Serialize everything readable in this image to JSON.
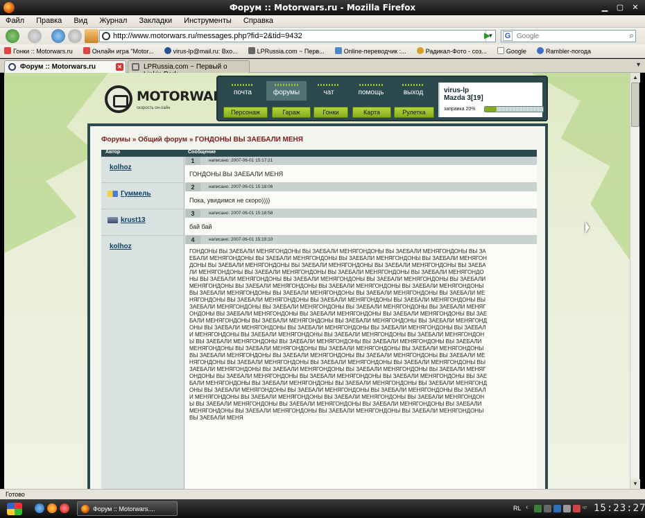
{
  "window": {
    "title": "Форум :: Motorwars.ru - Mozilla Firefox"
  },
  "menu": [
    "Файл",
    "Правка",
    "Вид",
    "Журнал",
    "Закладки",
    "Инструменты",
    "Справка"
  ],
  "url": "http://www.motorwars.ru/messages.php?fid=2&tid=9432",
  "search": {
    "placeholder": "Google",
    "engine_letter": "G"
  },
  "bookmarks": [
    "Гонки :: Motorwars.ru",
    "Онлайн игра \"Motor...",
    "virus-lp@mail.ru: Вхо...",
    "LPRussia.com ~ Перв...",
    "Online-переводчик :...",
    "Радикал-Фото - coз...",
    "Google",
    "Rambler-погода"
  ],
  "tabs": [
    {
      "label": "Форум :: Motorwars.ru",
      "active": true
    },
    {
      "label": "LPRussia.com ~ Первый о Linkin Park ...",
      "active": false
    }
  ],
  "site": {
    "logo": "MOTORWARS.RU",
    "tagline": "скорость он-лайн",
    "top_nav": [
      "почта",
      "форумы",
      "чат",
      "помощь",
      "выход"
    ],
    "sub_nav": [
      "Персонаж",
      "Гараж",
      "Гонки",
      "Карта",
      "Рулетка"
    ],
    "user": {
      "name": "virus-lp",
      "car": "Mazda 3[19]",
      "fuel_label": "заправка 20%",
      "fuel": 0.2
    }
  },
  "breadcrumb": {
    "forums": "Форумы",
    "sep1": "»",
    "general": "Общий форум",
    "sep2": "»",
    "topic": "ГОНДОНЫ ВЫ ЗАЕБАЛИ МЕНЯ"
  },
  "table": {
    "col_author": "Автор",
    "col_message": "Сообщение"
  },
  "posts": [
    {
      "num": "1",
      "author": "kolhoz",
      "date": "написано: 2007-06-01 15:17:21",
      "text": "ГОНДОНЫ ВЫ ЗАЕБАЛИ МЕНЯ"
    },
    {
      "num": "2",
      "author": "Гуммель",
      "date": "написано: 2007-06-01 15:18:06",
      "text": "Пока, увидимся не скоро))))"
    },
    {
      "num": "3",
      "author": "krust13",
      "date": "написано: 2007-06-01 15:18:58",
      "text": "бай бай"
    },
    {
      "num": "4",
      "author": "kolhoz",
      "date": "написано: 2007-06-01 15:19:10",
      "text": "ГОНДОНЫ ВЫ ЗАЕБАЛИ МЕНЯГОНДОНЫ ВЫ ЗАЕБАЛИ МЕНЯГОНДОНЫ ВЫ ЗАЕБАЛИ МЕНЯГОНДОНЫ ВЫ ЗАЕБАЛИ МЕНЯГОНДОНЫ ВЫ ЗАЕБАЛИ МЕНЯГОНДОНЫ ВЫ ЗАЕБАЛИ МЕНЯГОНДОНЫ ВЫ ЗАЕБАЛИ МЕНЯГОНДОНЫ ВЫ ЗАЕБАЛИ МЕНЯГОНДОНЫ ВЫ ЗАЕБАЛИ МЕНЯГОНДОНЫ ВЫ ЗАЕБАЛИ МЕНЯГОНДОНЫ ВЫ ЗАЕБАЛИ МЕНЯГОНДОНЫ ВЫ ЗАЕБАЛИ МЕНЯГОНДОНЫ ВЫ ЗАЕБАЛИ МЕНЯГОНДОНЫ ВЫ ЗАЕБАЛИ МЕНЯГОНДОНЫ ВЫ ЗАЕБАЛИ МЕНЯГОНДОНЫ ВЫ ЗАЕБАЛИ МЕНЯГОНДОНЫ ВЫ ЗАЕБАЛИ МЕНЯГОНДОНЫ ВЫ ЗАЕБАЛИ МЕНЯГОНДОНЫ ВЫ ЗАЕБАЛИ МЕНЯГОНДОНЫ ВЫ ЗАЕБАЛИ МЕНЯГОНДОНЫ ВЫ ЗАЕБАЛИ МЕНЯГОНДОНЫ ВЫ ЗАЕБАЛИ МЕНЯГОНДОНЫ ВЫ ЗАЕБАЛИ МЕНЯГОНДОНЫ ВЫ ЗАЕБАЛИ МЕНЯГОНДОНЫ ВЫ ЗАЕБАЛИ МЕНЯГОНДОНЫ ВЫ ЗАЕБАЛИ МЕНЯГОНДОНЫ ВЫ ЗАЕБАЛИ МЕНЯГОНДОНЫ ВЫ ЗАЕБАЛИ МЕНЯГОНДОНЫ ВЫ ЗАЕБАЛИ МЕНЯГОНДОНЫ ВЫ ЗАЕБАЛИ МЕНЯГОНДОНЫ ВЫ ЗАЕБАЛИ МЕНЯГОНДОНЫ ВЫ ЗАЕБАЛИ МЕНЯГОНДОНЫ ВЫ ЗАЕБАЛИ МЕНЯГОНДОНЫ ВЫ ЗАЕБАЛИ МЕНЯГОНДОНЫ ВЫ ЗАЕБАЛИ МЕНЯГОНДОНЫ ВЫ ЗАЕБАЛИ МЕНЯГОНДОНЫ ВЫ ЗАЕБАЛИ МЕНЯГОНДОНЫ ВЫ ЗАЕБАЛИ МЕНЯГОНДОНЫ ВЫ ЗАЕБАЛИ МЕНЯГОНДОНЫ ВЫ ЗАЕБАЛИ МЕНЯГОНДОНЫ ВЫ ЗАЕБАЛИ МЕНЯГОНДОНЫ ВЫ ЗАЕБАЛИ МЕНЯГОНДОНЫ ВЫ ЗАЕБАЛИ МЕНЯГОНДОНЫ ВЫ ЗАЕБАЛИ МЕНЯГОНДОНЫ ВЫ ЗАЕБАЛИ МЕНЯГОНДОНЫ ВЫ ЗАЕБАЛИ МЕНЯГОНДОНЫ ВЫ ЗАЕБАЛИ МЕНЯГОНДОНЫ ВЫ ЗАЕБАЛИ МЕНЯГОНДОНЫ ВЫ ЗАЕБАЛИ МЕНЯГОНДОНЫ ВЫ ЗАЕБАЛИ МЕНЯГОНДОНЫ ВЫ ЗАЕБАЛИ МЕНЯГОНДОНЫ ВЫ ЗАЕБАЛИ МЕНЯГОНДОНЫ ВЫ ЗАЕБАЛИ МЕНЯГОНДОНЫ ВЫ ЗАЕБАЛИ МЕНЯГОНДОНЫ ВЫ ЗАЕБАЛИ МЕНЯГОНДОНЫ ВЫ ЗАЕБАЛИ МЕНЯГОНДОНЫ ВЫ ЗАЕБАЛИ МЕНЯГОНДОНЫ ВЫ ЗАЕБАЛИ МЕНЯГОНДОНЫ ВЫ ЗАЕБАЛИ МЕНЯГОНДОНЫ ВЫ ЗАЕБАЛИ МЕНЯГОНДОНЫ ВЫ ЗАЕБАЛИ МЕНЯГОНДОНЫ ВЫ ЗАЕБАЛИ МЕНЯГОНДОНЫ ВЫ ЗАЕБАЛИ МЕНЯГОНДОНЫ ВЫ ЗАЕБАЛИ МЕНЯГОНДОНЫ ВЫ ЗАЕБАЛИ МЕНЯГОНДОНЫ ВЫ ЗАЕБАЛИ МЕНЯГОНДОНЫ ВЫ ЗАЕБАЛИ МЕНЯГОНДОНЫ ВЫ ЗАЕБАЛИ МЕНЯГОНДОНЫ ВЫ ЗАЕБАЛИ МЕНЯГОНДОНЫ ВЫ ЗАЕБАЛИ МЕНЯГОНДОНЫ ВЫ ЗАЕБАЛИ МЕНЯГОНДОНЫ ВЫ ЗАЕБАЛИ МЕНЯГОНДОНЫ ВЫ ЗАЕБАЛИ МЕНЯГОНДОНЫ ВЫ ЗАЕБАЛИ МЕНЯГОНДОНЫ ВЫ ЗАЕБАЛИ МЕНЯГОНДОНЫ ВЫ ЗАЕБАЛИ МЕНЯГОНДОНЫ ВЫ ЗАЕБАЛИ МЕНЯГОНДОНЫ ВЫ ЗАЕБАЛИ МЕНЯГОНДОНЫ ВЫ ЗАЕБАЛИ МЕНЯГОНДОНЫ ВЫ ЗАЕБАЛИ МЕНЯГОНДОНЫ ВЫ ЗАЕБАЛИ МЕНЯГОНДОНЫ ВЫ ЗАЕБАЛИ МЕНЯГОНДОНЫ ВЫ ЗАЕБАЛИ МЕНЯГОНДОНЫ ВЫ ЗАЕБАЛИ МЕНЯГОНДОНЫ ВЫ ЗАЕБАЛИ МЕНЯГОНДОНЫ ВЫ ЗАЕБАЛИ МЕНЯ"
    }
  ],
  "status": "Готово",
  "taskbar": {
    "item": "Форум :: Motorwars....",
    "lang": "RL",
    "day": "ЧТ",
    "clock": "15:23:27"
  }
}
